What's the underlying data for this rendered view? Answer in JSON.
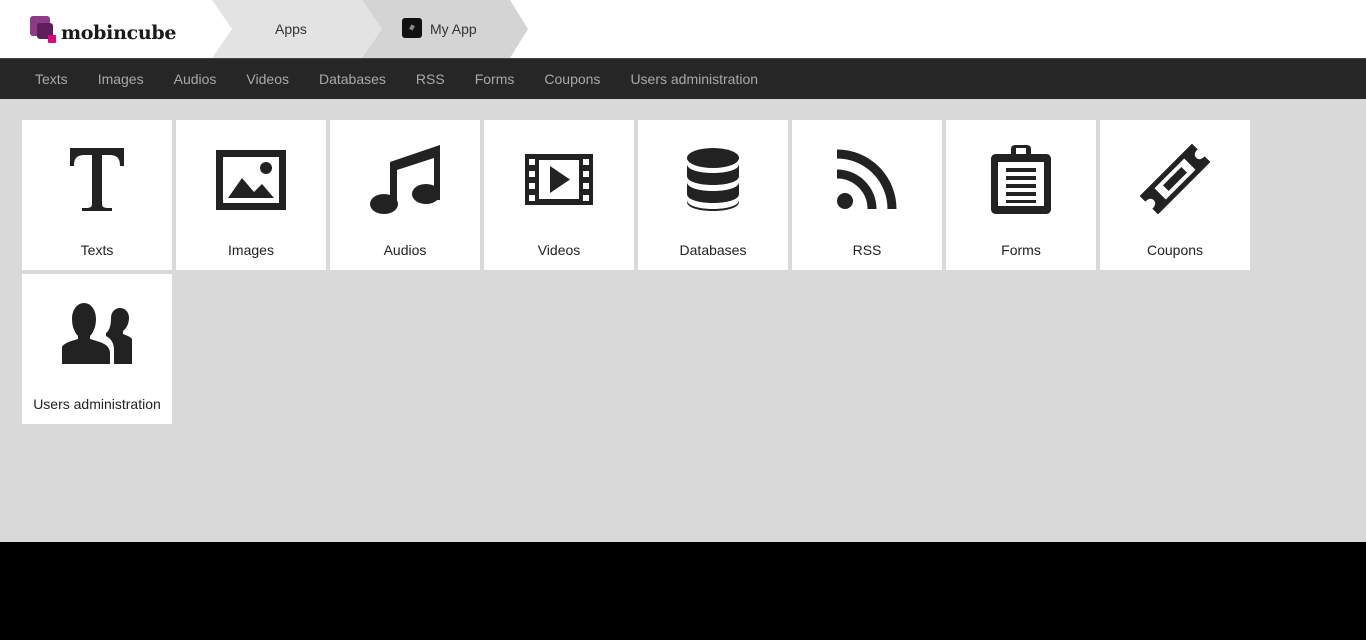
{
  "header": {
    "logo_text": "mobincube",
    "breadcrumb": [
      {
        "label": "Apps"
      },
      {
        "label": "My App"
      }
    ]
  },
  "nav": {
    "items": [
      {
        "label": "Texts"
      },
      {
        "label": "Images"
      },
      {
        "label": "Audios"
      },
      {
        "label": "Videos"
      },
      {
        "label": "Databases"
      },
      {
        "label": "RSS"
      },
      {
        "label": "Forms"
      },
      {
        "label": "Coupons"
      },
      {
        "label": "Users administration"
      }
    ]
  },
  "tiles": [
    {
      "label": "Texts",
      "icon": "text-icon"
    },
    {
      "label": "Images",
      "icon": "image-icon"
    },
    {
      "label": "Audios",
      "icon": "music-note-icon"
    },
    {
      "label": "Videos",
      "icon": "film-icon"
    },
    {
      "label": "Databases",
      "icon": "database-icon"
    },
    {
      "label": "RSS",
      "icon": "rss-icon"
    },
    {
      "label": "Forms",
      "icon": "clipboard-icon"
    },
    {
      "label": "Coupons",
      "icon": "ticket-icon"
    },
    {
      "label": "Users administration",
      "icon": "users-icon"
    }
  ],
  "colors": {
    "background": "#d9d9d9",
    "nav_background": "#262626",
    "nav_text": "#a9a9a9",
    "icon": "#222222",
    "logo_accent": "#8e3a86"
  }
}
